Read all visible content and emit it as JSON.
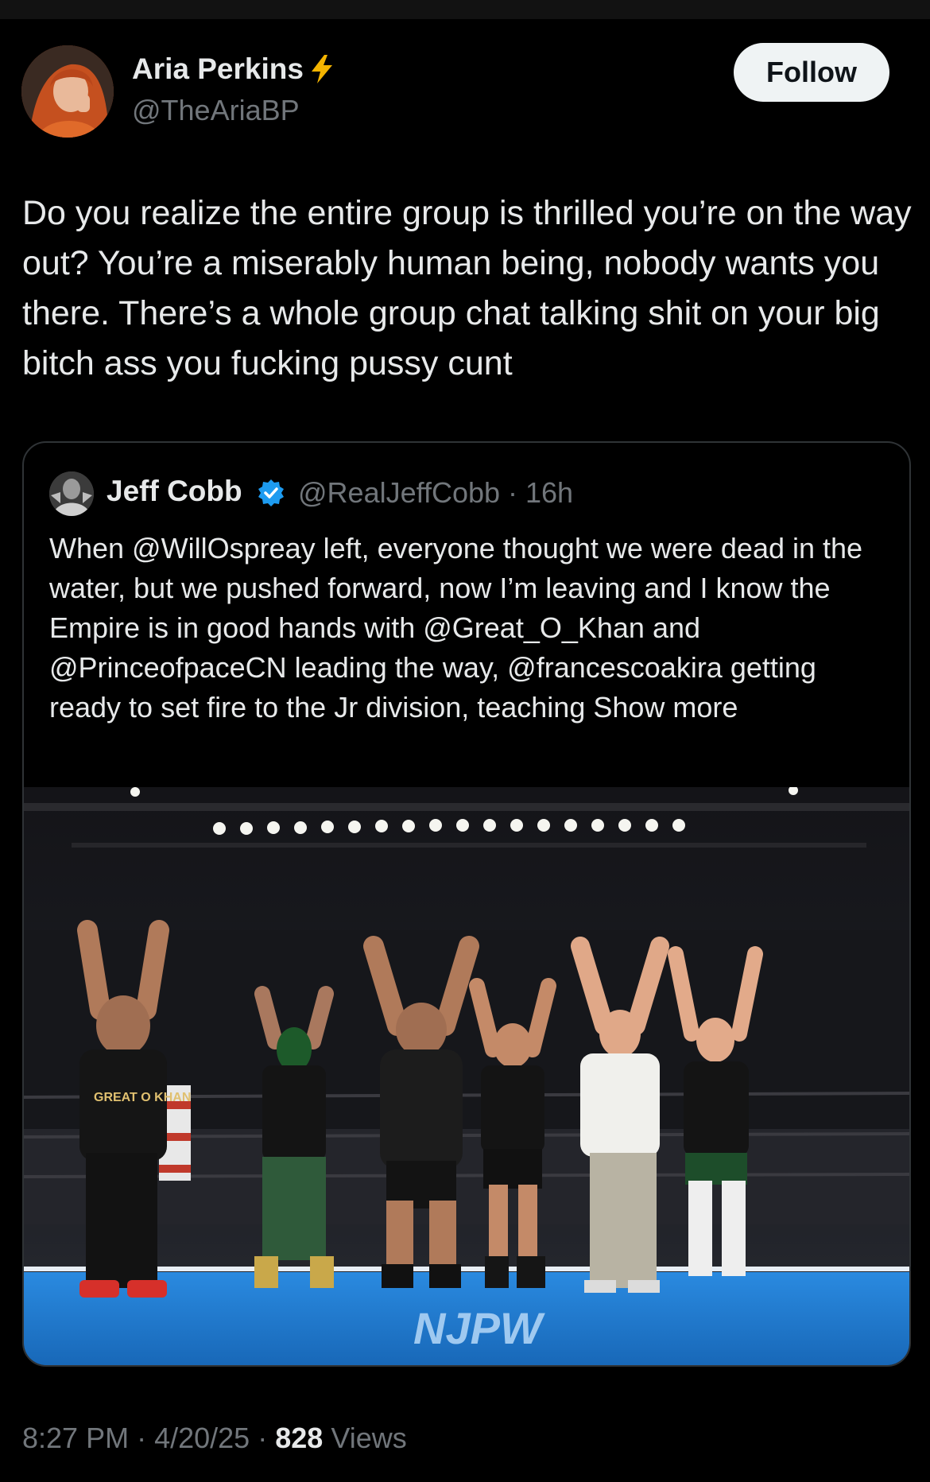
{
  "tweet": {
    "author_name": "Aria Perkins",
    "author_handle": "@TheAriaBP",
    "follow_label": "Follow",
    "badge_icon": "lightning-bolt-icon",
    "text": "Do you realize the entire group is thrilled you’re on the way out? You’re a miserably human being, nobody wants you there. There’s a whole group chat talking shit on your big bitch ass you fucking pussy cunt",
    "time": "8:27 PM",
    "date": "4/20/25",
    "views_count": "828",
    "views_label": "Views"
  },
  "quote": {
    "author_name": "Jeff Cobb",
    "verified_icon": "verified-badge-icon",
    "handle_time": "@RealJeffCobb · 16h",
    "text": "When @WillOspreay left, everyone thought we were dead in the water, but we pushed forward, now I’m leaving and I know the Empire is in good hands with @Great_O_Khan and @PrinceofpaceCN leading the way, @francescoakira getting ready to set fire to the Jr division, teaching Show more",
    "photo_banner": "NJPW",
    "photo_shirt": "GREAT O KHAN"
  },
  "colors": {
    "background": "#000000",
    "text": "#e7e9ea",
    "muted": "#71767b",
    "verified": "#1d9bf0",
    "bolt": "#f4b400",
    "mat": "#1f7fd6"
  }
}
